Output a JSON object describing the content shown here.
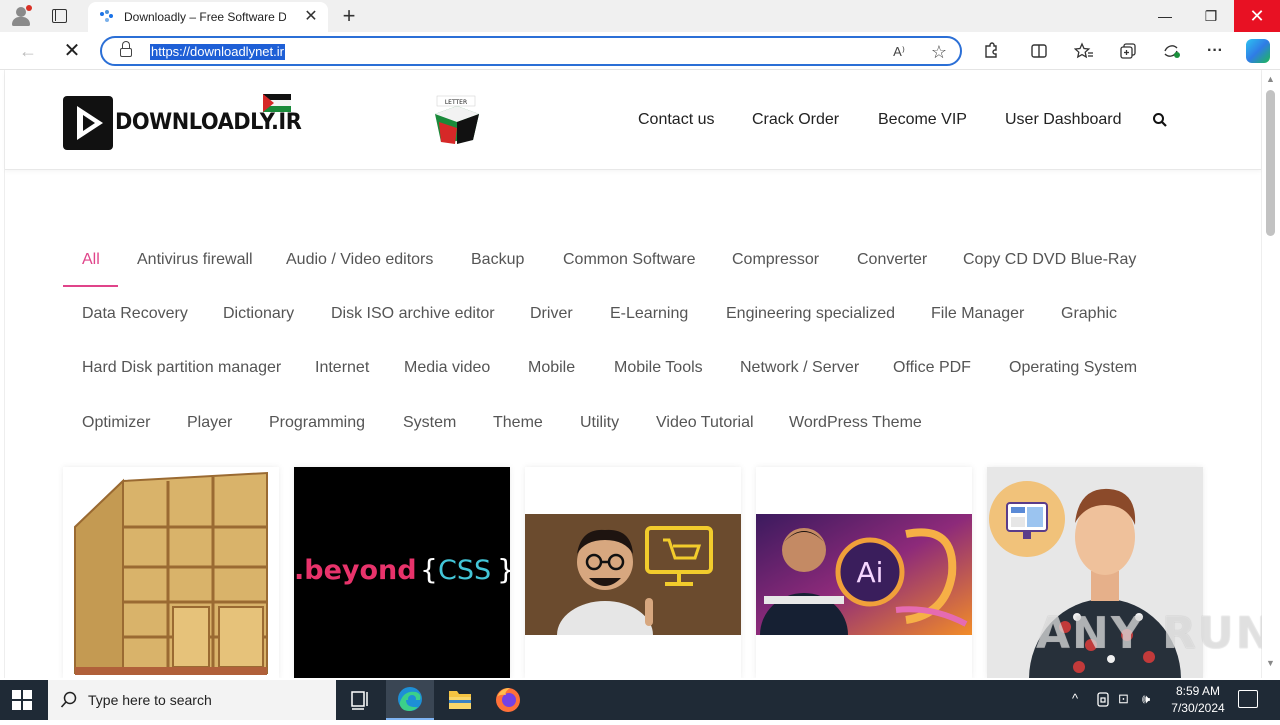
{
  "browser": {
    "tab_title": "Downloadly – Free Software Dow",
    "tab_close": "✕",
    "new_tab": "+",
    "url": "https://downloadlynet.ir",
    "window": {
      "minimize": "—",
      "maximize": "❐",
      "close": "✕"
    },
    "nav": {
      "back": "←",
      "stop": "✕"
    },
    "toolbar_icons": [
      "read-aloud-icon",
      "favorites-star-icon",
      "extensions-icon",
      "split-screen-icon",
      "favorites-icon",
      "collections-icon",
      "browser-essentials-icon",
      "more-menu-icon",
      "copilot-icon"
    ]
  },
  "site": {
    "logo_text": "DOWNLOADLY.IR",
    "badge_text": "LETTER",
    "menu": {
      "contact": "Contact us",
      "crack_order": "Crack Order",
      "vip": "Become VIP",
      "dashboard": "User Dashboard"
    },
    "filters": [
      "All",
      "Antivirus firewall",
      "Audio / Video editors",
      "Backup",
      "Common Software",
      "Compressor",
      "Converter",
      "Copy CD DVD Blue-Ray",
      "Data Recovery",
      "Dictionary",
      "Disk ISO archive editor",
      "Driver",
      "E-Learning",
      "Engineering specialized",
      "File Manager",
      "Graphic",
      "Hard Disk partition manager",
      "Internet",
      "Media video",
      "Mobile",
      "Mobile Tools",
      "Network / Server",
      "Office PDF",
      "Operating System",
      "Optimizer",
      "Player",
      "Programming",
      "System",
      "Theme",
      "Utility",
      "Video Tutorial",
      "WordPress Theme"
    ],
    "active_filter": "All",
    "cards": {
      "beyond_text": ".beyond",
      "css_open": "{",
      "css_text": "CSS",
      "css_close": "}",
      "ai_text": "Ai"
    },
    "colors": {
      "accent": "#e0448a"
    }
  },
  "watermark": "ANY RUN",
  "taskbar": {
    "search_placeholder": "Type here to search",
    "time": "8:59 AM",
    "date": "7/30/2024",
    "tray": {
      "chevron": "^",
      "network": "⊡",
      "volume": "🕪"
    }
  }
}
